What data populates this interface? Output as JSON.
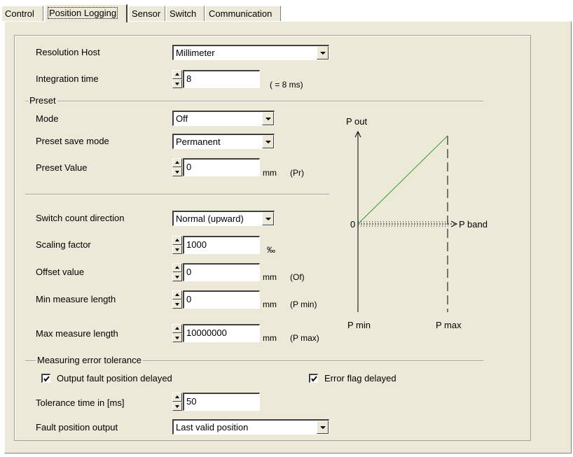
{
  "tabs": [
    {
      "label": "Control",
      "active": false
    },
    {
      "label": "Position Logging",
      "active": true
    },
    {
      "label": "Sensor",
      "active": false
    },
    {
      "label": "Switch",
      "active": false
    },
    {
      "label": "Communication",
      "active": false
    }
  ],
  "resolution_host": {
    "label": "Resolution Host",
    "value": "Millimeter"
  },
  "integration_time": {
    "label": "Integration time",
    "value": "8",
    "note": "( = 8 ms)"
  },
  "preset": {
    "group_label": "Preset",
    "mode": {
      "label": "Mode",
      "value": "Off"
    },
    "save_mode": {
      "label": "Preset save mode",
      "value": "Permanent"
    },
    "value": {
      "label": "Preset Value",
      "value": "0",
      "unit": "mm",
      "abbr": "(Pr)"
    }
  },
  "switch_count_direction": {
    "label": "Switch count direction",
    "value": "Normal (upward)"
  },
  "scaling_factor": {
    "label": "Scaling factor",
    "value": "1000",
    "unit": "‰"
  },
  "offset_value": {
    "label": "Offset value",
    "value": "0",
    "unit": "mm",
    "abbr": "(Of)"
  },
  "min_measure_length": {
    "label": "Min measure length",
    "value": "0",
    "unit": "mm",
    "abbr": "(P min)"
  },
  "max_measure_length": {
    "label": "Max measure length",
    "value": "10000000",
    "unit": "mm",
    "abbr": "(P max)"
  },
  "diagram": {
    "p_out": "P out",
    "zero": "0",
    "p_band": "P band",
    "p_min": "P min",
    "p_max": "P max",
    "line_color": "#2e9e2e"
  },
  "error_tolerance": {
    "group_label": "Measuring error tolerance",
    "output_fault_delayed": {
      "label": "Output fault position delayed",
      "checked": true
    },
    "error_flag_delayed": {
      "label": "Error flag delayed",
      "checked": true
    },
    "tolerance_time": {
      "label": "Tolerance time in [ms]",
      "value": "50"
    },
    "fault_position_output": {
      "label": "Fault position output",
      "value": "Last valid position"
    }
  }
}
